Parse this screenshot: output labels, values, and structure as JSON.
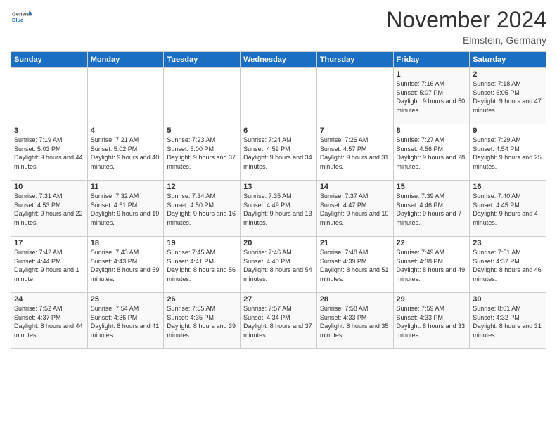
{
  "header": {
    "logo_general": "General",
    "logo_blue": "Blue",
    "month_title": "November 2024",
    "location": "Elmstein, Germany"
  },
  "weekdays": [
    "Sunday",
    "Monday",
    "Tuesday",
    "Wednesday",
    "Thursday",
    "Friday",
    "Saturday"
  ],
  "weeks": [
    [
      {
        "day": "",
        "sunrise": "",
        "sunset": "",
        "daylight": ""
      },
      {
        "day": "",
        "sunrise": "",
        "sunset": "",
        "daylight": ""
      },
      {
        "day": "",
        "sunrise": "",
        "sunset": "",
        "daylight": ""
      },
      {
        "day": "",
        "sunrise": "",
        "sunset": "",
        "daylight": ""
      },
      {
        "day": "",
        "sunrise": "",
        "sunset": "",
        "daylight": ""
      },
      {
        "day": "1",
        "sunrise": "Sunrise: 7:16 AM",
        "sunset": "Sunset: 5:07 PM",
        "daylight": "Daylight: 9 hours and 50 minutes."
      },
      {
        "day": "2",
        "sunrise": "Sunrise: 7:18 AM",
        "sunset": "Sunset: 5:05 PM",
        "daylight": "Daylight: 9 hours and 47 minutes."
      }
    ],
    [
      {
        "day": "3",
        "sunrise": "Sunrise: 7:19 AM",
        "sunset": "Sunset: 5:03 PM",
        "daylight": "Daylight: 9 hours and 44 minutes."
      },
      {
        "day": "4",
        "sunrise": "Sunrise: 7:21 AM",
        "sunset": "Sunset: 5:02 PM",
        "daylight": "Daylight: 9 hours and 40 minutes."
      },
      {
        "day": "5",
        "sunrise": "Sunrise: 7:23 AM",
        "sunset": "Sunset: 5:00 PM",
        "daylight": "Daylight: 9 hours and 37 minutes."
      },
      {
        "day": "6",
        "sunrise": "Sunrise: 7:24 AM",
        "sunset": "Sunset: 4:59 PM",
        "daylight": "Daylight: 9 hours and 34 minutes."
      },
      {
        "day": "7",
        "sunrise": "Sunrise: 7:26 AM",
        "sunset": "Sunset: 4:57 PM",
        "daylight": "Daylight: 9 hours and 31 minutes."
      },
      {
        "day": "8",
        "sunrise": "Sunrise: 7:27 AM",
        "sunset": "Sunset: 4:56 PM",
        "daylight": "Daylight: 9 hours and 28 minutes."
      },
      {
        "day": "9",
        "sunrise": "Sunrise: 7:29 AM",
        "sunset": "Sunset: 4:54 PM",
        "daylight": "Daylight: 9 hours and 25 minutes."
      }
    ],
    [
      {
        "day": "10",
        "sunrise": "Sunrise: 7:31 AM",
        "sunset": "Sunset: 4:53 PM",
        "daylight": "Daylight: 9 hours and 22 minutes."
      },
      {
        "day": "11",
        "sunrise": "Sunrise: 7:32 AM",
        "sunset": "Sunset: 4:51 PM",
        "daylight": "Daylight: 9 hours and 19 minutes."
      },
      {
        "day": "12",
        "sunrise": "Sunrise: 7:34 AM",
        "sunset": "Sunset: 4:50 PM",
        "daylight": "Daylight: 9 hours and 16 minutes."
      },
      {
        "day": "13",
        "sunrise": "Sunrise: 7:35 AM",
        "sunset": "Sunset: 4:49 PM",
        "daylight": "Daylight: 9 hours and 13 minutes."
      },
      {
        "day": "14",
        "sunrise": "Sunrise: 7:37 AM",
        "sunset": "Sunset: 4:47 PM",
        "daylight": "Daylight: 9 hours and 10 minutes."
      },
      {
        "day": "15",
        "sunrise": "Sunrise: 7:39 AM",
        "sunset": "Sunset: 4:46 PM",
        "daylight": "Daylight: 9 hours and 7 minutes."
      },
      {
        "day": "16",
        "sunrise": "Sunrise: 7:40 AM",
        "sunset": "Sunset: 4:45 PM",
        "daylight": "Daylight: 9 hours and 4 minutes."
      }
    ],
    [
      {
        "day": "17",
        "sunrise": "Sunrise: 7:42 AM",
        "sunset": "Sunset: 4:44 PM",
        "daylight": "Daylight: 9 hours and 1 minute."
      },
      {
        "day": "18",
        "sunrise": "Sunrise: 7:43 AM",
        "sunset": "Sunset: 4:43 PM",
        "daylight": "Daylight: 8 hours and 59 minutes."
      },
      {
        "day": "19",
        "sunrise": "Sunrise: 7:45 AM",
        "sunset": "Sunset: 4:41 PM",
        "daylight": "Daylight: 8 hours and 56 minutes."
      },
      {
        "day": "20",
        "sunrise": "Sunrise: 7:46 AM",
        "sunset": "Sunset: 4:40 PM",
        "daylight": "Daylight: 8 hours and 54 minutes."
      },
      {
        "day": "21",
        "sunrise": "Sunrise: 7:48 AM",
        "sunset": "Sunset: 4:39 PM",
        "daylight": "Daylight: 8 hours and 51 minutes."
      },
      {
        "day": "22",
        "sunrise": "Sunrise: 7:49 AM",
        "sunset": "Sunset: 4:38 PM",
        "daylight": "Daylight: 8 hours and 49 minutes."
      },
      {
        "day": "23",
        "sunrise": "Sunrise: 7:51 AM",
        "sunset": "Sunset: 4:37 PM",
        "daylight": "Daylight: 8 hours and 46 minutes."
      }
    ],
    [
      {
        "day": "24",
        "sunrise": "Sunrise: 7:52 AM",
        "sunset": "Sunset: 4:37 PM",
        "daylight": "Daylight: 8 hours and 44 minutes."
      },
      {
        "day": "25",
        "sunrise": "Sunrise: 7:54 AM",
        "sunset": "Sunset: 4:36 PM",
        "daylight": "Daylight: 8 hours and 41 minutes."
      },
      {
        "day": "26",
        "sunrise": "Sunrise: 7:55 AM",
        "sunset": "Sunset: 4:35 PM",
        "daylight": "Daylight: 8 hours and 39 minutes."
      },
      {
        "day": "27",
        "sunrise": "Sunrise: 7:57 AM",
        "sunset": "Sunset: 4:34 PM",
        "daylight": "Daylight: 8 hours and 37 minutes."
      },
      {
        "day": "28",
        "sunrise": "Sunrise: 7:58 AM",
        "sunset": "Sunset: 4:33 PM",
        "daylight": "Daylight: 8 hours and 35 minutes."
      },
      {
        "day": "29",
        "sunrise": "Sunrise: 7:59 AM",
        "sunset": "Sunset: 4:33 PM",
        "daylight": "Daylight: 8 hours and 33 minutes."
      },
      {
        "day": "30",
        "sunrise": "Sunrise: 8:01 AM",
        "sunset": "Sunset: 4:32 PM",
        "daylight": "Daylight: 8 hours and 31 minutes."
      }
    ]
  ]
}
